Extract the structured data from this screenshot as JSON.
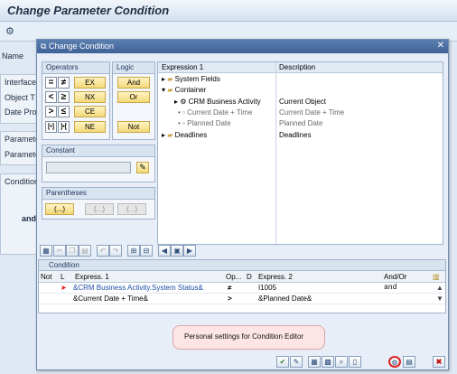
{
  "app": {
    "title": "Change Parameter Condition"
  },
  "background": {
    "labels": [
      "Name",
      "Interface",
      "Object T",
      "Date Pro",
      "Paramete",
      "Paramete",
      "Condition",
      "and"
    ]
  },
  "dialog": {
    "title": "Change Condition",
    "operators": {
      "header": "Operators",
      "symbols": [
        "=",
        "≠",
        "<",
        "≥",
        ">",
        "≤",
        "[•]",
        "]•["
      ],
      "buttons": [
        "EX",
        "NX",
        "CE",
        "NE"
      ]
    },
    "logic": {
      "header": "Logic",
      "buttons": [
        "And",
        "Or",
        "Not"
      ]
    },
    "constant": {
      "header": "Constant",
      "value": ""
    },
    "parentheses": {
      "header": "Parentheses",
      "buttons": [
        "(...)",
        "(...)",
        "(...)"
      ]
    },
    "tree": {
      "col1": "Expression 1",
      "col2": "Description",
      "rows": [
        {
          "label": "System Fields",
          "desc": ""
        },
        {
          "label": "Container",
          "desc": ""
        },
        {
          "label": "CRM Business Activity",
          "desc": "Current Object"
        },
        {
          "label": "Current Date + Time",
          "desc": "Current Date + Time"
        },
        {
          "label": "Planned Date",
          "desc": "Planned Date"
        },
        {
          "label": "Deadlines",
          "desc": "Deadlines"
        }
      ]
    },
    "condition": {
      "caption": "Condition",
      "headers": [
        "Not",
        "L",
        "Express. 1",
        "Op...",
        "D",
        "Express. 2",
        "And/Or"
      ],
      "rows": [
        {
          "expr1": "&CRM Business Activity.System Status&",
          "op": "≠",
          "expr2": "I1005",
          "andor": "and"
        },
        {
          "expr1": "&Current Date + Time&",
          "op": ">",
          "expr2": "&Planned Date&",
          "andor": ""
        }
      ]
    },
    "tooltip": "Personal settings for Condition Editor"
  }
}
